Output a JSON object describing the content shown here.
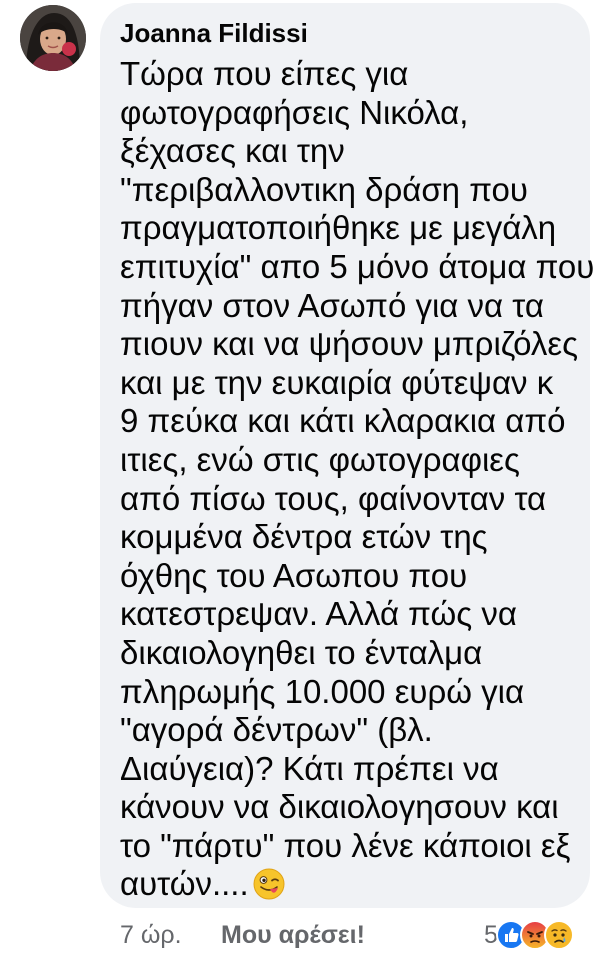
{
  "comment": {
    "author": "Joanna Fildissi",
    "lines": [
      "Τώρα που είπες για",
      "φωτογραφήσεις Νικόλα,",
      "ξέχασες και την",
      "\"περιβαλλοντικη δράση που",
      "πραγματοποιήθηκε με μεγάλη",
      "επιτυχία\" απο 5 μόνο άτομα που",
      "πήγαν στον Ασωπό για να τα",
      "πιουν και να ψήσουν μπριζόλες",
      "και με την ευκαιρία φύτεψαν κ",
      "9 πεύκα και κάτι κλαρακια από",
      "ιτιες, ενώ στις φωτογραφιες",
      "από πίσω τους, φαίνονταν τα",
      "κομμένα δέντρα ετών της",
      "όχθης του Ασωπου που",
      "κατεστρεψαν. Αλλά πώς να",
      "δικαιολογηθει το ένταλμα",
      "πληρωμής 10.000 ευρώ για",
      "\"αγορά δέντρων\" (βλ.",
      "Διαύγεια)? Κάτι πρέπει να",
      "κάνουν να δικαιολογησουν και",
      "το \"πάρτυ\" που λένε κάποιοι εξ",
      "αυτών...."
    ],
    "trailing_emoji": "winking-face-with-tongue"
  },
  "footer": {
    "time": "7 ώρ.",
    "like_label": "Μου αρέσει!",
    "reaction_count": "5",
    "reaction_icons": [
      "like",
      "angry",
      "sad"
    ]
  },
  "colors": {
    "bubble": "#f0f2f5",
    "text": "#050505",
    "meta": "#65676b",
    "like_blue": "#1877f2",
    "angry_red": "#e9710f",
    "sad_yellow": "#f7b928"
  }
}
